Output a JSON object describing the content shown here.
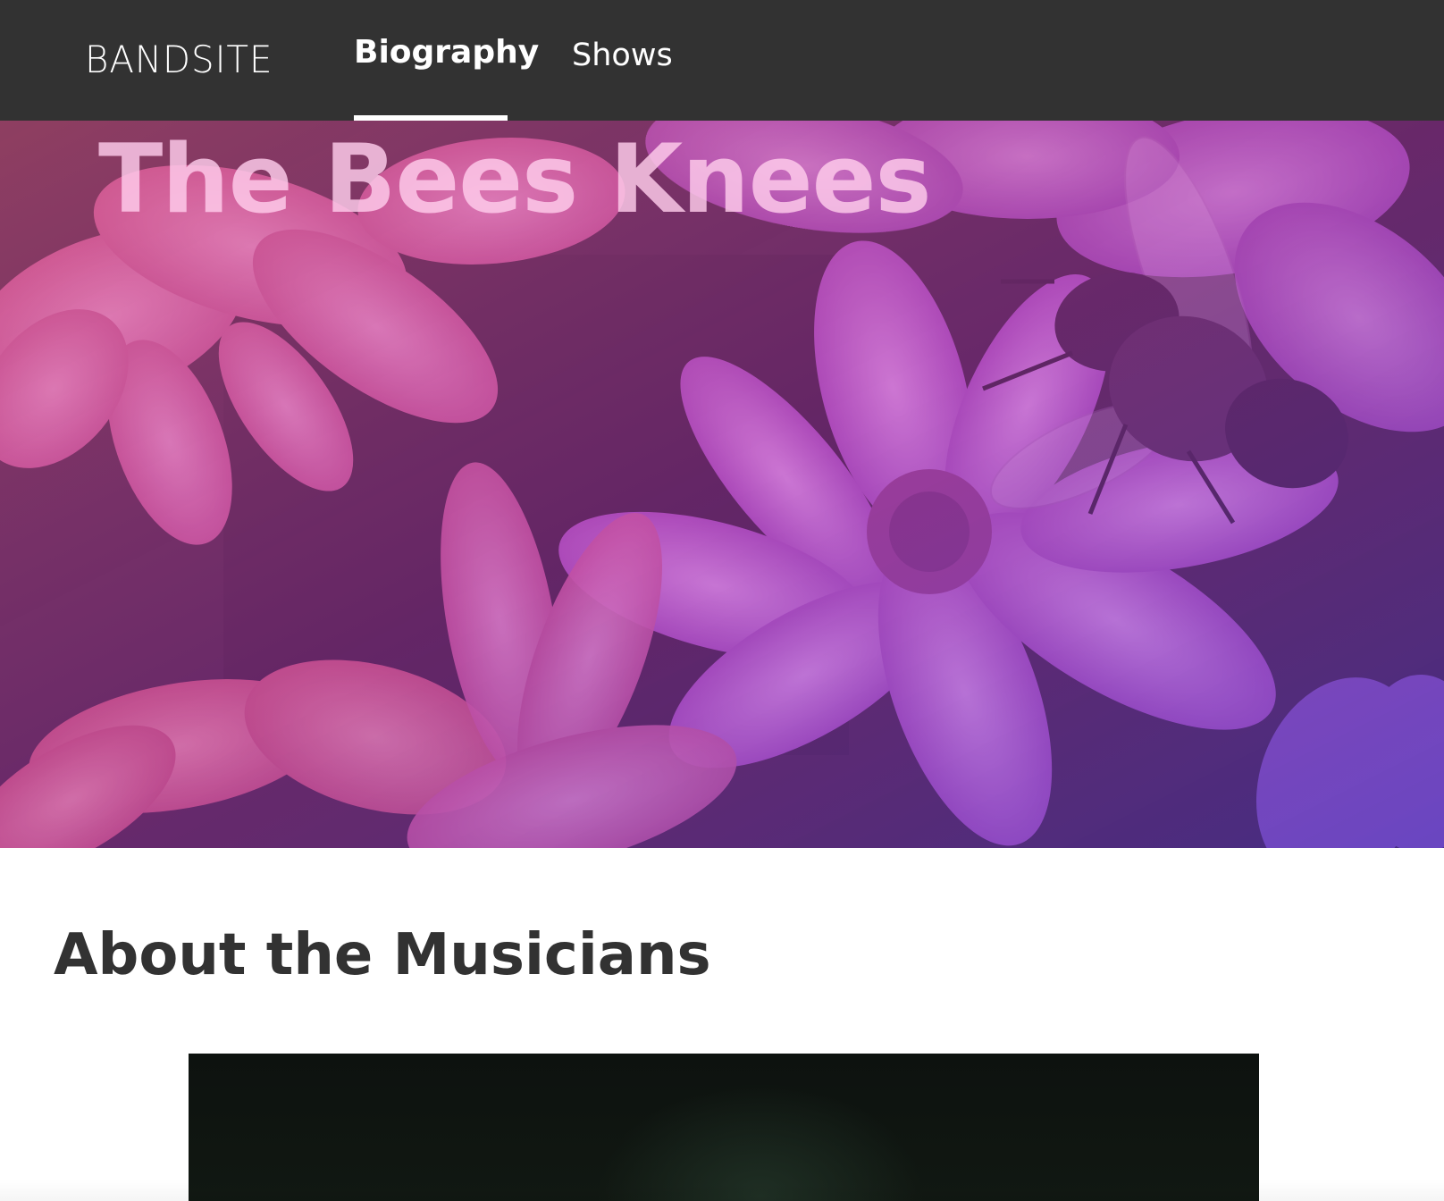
{
  "header": {
    "logo": "BANDSITE",
    "nav": [
      {
        "label": "Biography",
        "active": true
      },
      {
        "label": "Shows",
        "active": false
      }
    ]
  },
  "hero": {
    "title": "The Bees Knees",
    "image_icon": "flower-bee-photo"
  },
  "about": {
    "title": "About the Musicians",
    "image_icon": "musician-photo"
  },
  "colors": {
    "header_bg": "#323232",
    "nav_text": "#ffffff",
    "heading_text": "#323232",
    "hero_tint_pink": "#d86ab0",
    "hero_tint_purple": "#8a3fb8"
  }
}
